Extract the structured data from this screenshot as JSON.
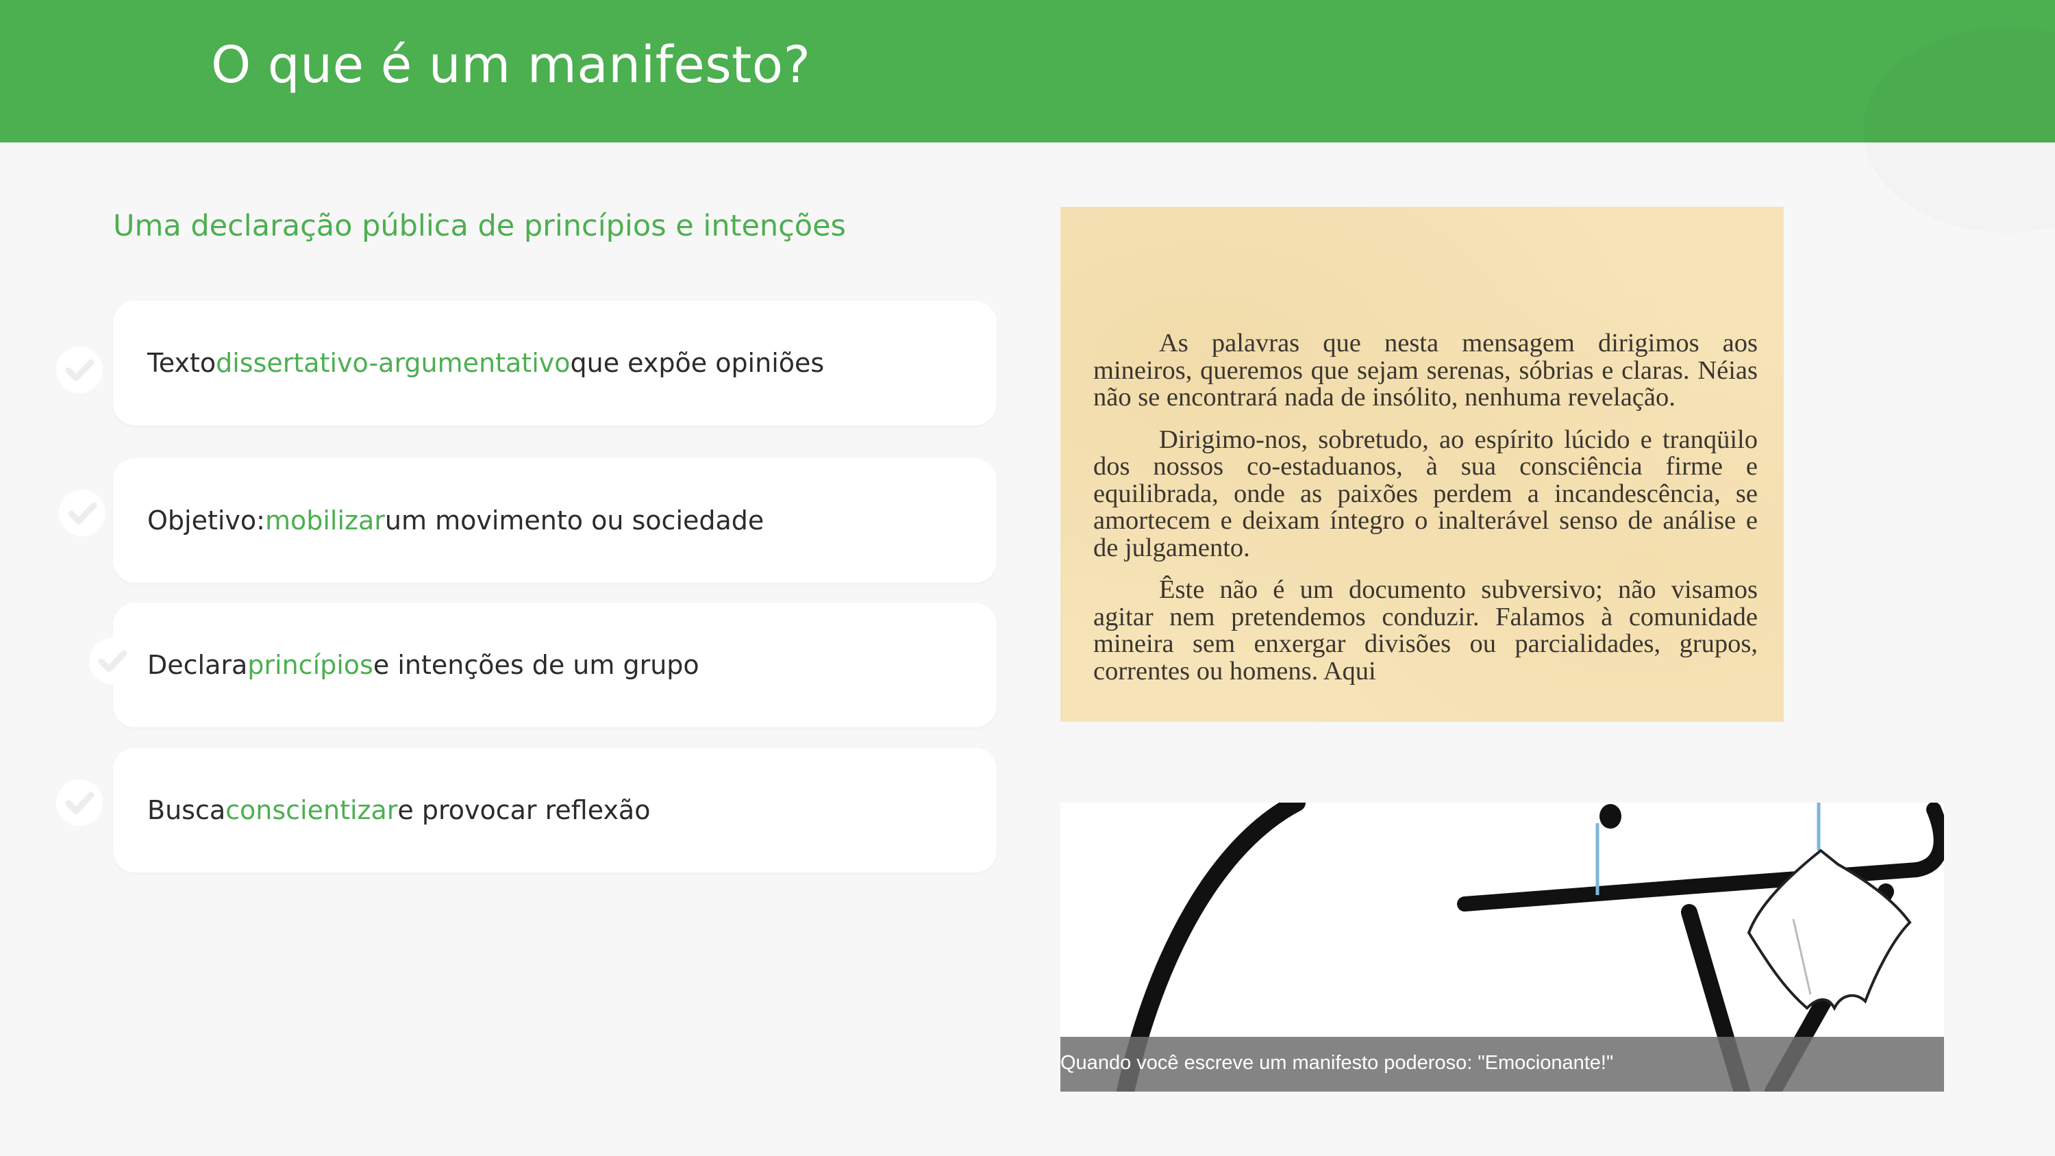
{
  "header": {
    "title": "O que é um manifesto?"
  },
  "main": {
    "subtitle": "Uma declaração pública de princípios e intenções",
    "items": [
      {
        "before": "Texto ",
        "highlight": "dissertativo-argumentativo",
        "after": " que expõe opiniões"
      },
      {
        "before": "Objetivo: ",
        "highlight": "mobilizar",
        "after": " um movimento ou sociedade"
      },
      {
        "before": "Declara ",
        "highlight": "princípios",
        "after": " e intenções de um grupo"
      },
      {
        "before": "Busca ",
        "highlight": "conscientizar",
        "after": " e provocar reflexão"
      }
    ]
  },
  "document_image": {
    "paragraphs": [
      "As palavras que nesta mensagem dirigimos aos mineiros, queremos que sejam serenas, sóbrias e claras. Néias não se encontrará nada de insólito, nenhuma revelação.",
      "Dirigimo-nos, sobretudo, ao espírito lúcido e tranqüilo dos nossos co-estaduanos, à sua consciência firme e equilibrada, onde as paixões perdem a incandescência, se amortecem e deixam íntegro o inalterável senso de análise e de julgamento.",
      "Êste não é um documento subversivo; não visamos agitar nem pretendemos conduzir. Falamos à comunidade mineira sem enxergar divisões ou parcialidades, grupos, correntes ou homens. Aqui"
    ]
  },
  "meme": {
    "caption": "Quando você escreve um manifesto poderoso: \"Emocionante!\""
  },
  "colors": {
    "accent": "#4caf50",
    "header_bg": "#4caf50",
    "page_bg": "#f7f7f7",
    "text": "#2b2b2b"
  }
}
